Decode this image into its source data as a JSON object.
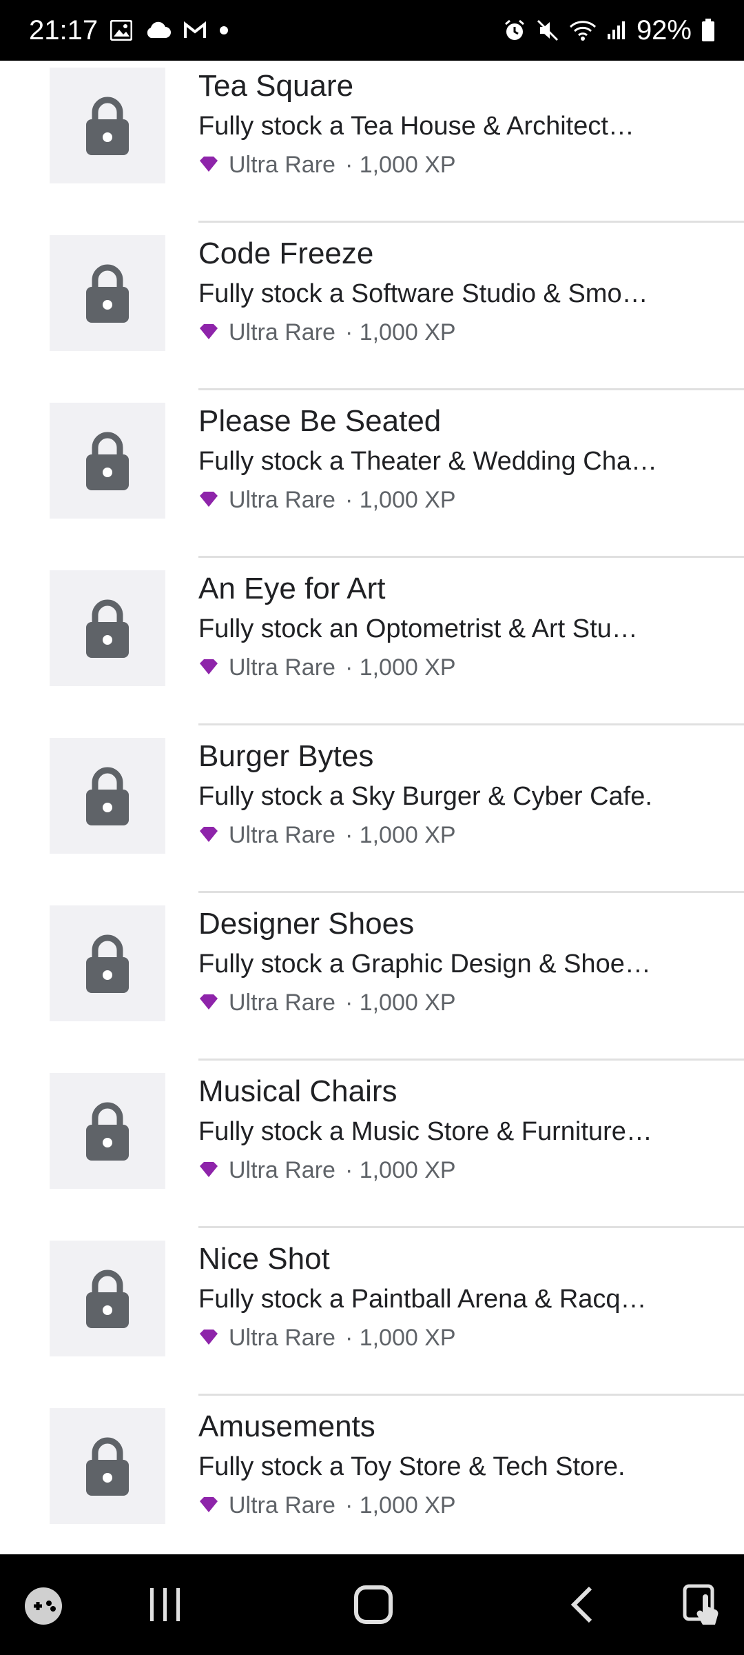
{
  "status_bar": {
    "time": "21:17",
    "battery": "92%",
    "icons_left": [
      "image-icon",
      "cloud-icon",
      "gmail-icon",
      "dot-icon"
    ],
    "icons_right": [
      "alarm-icon",
      "mute-icon",
      "wifi-icon",
      "signal-icon",
      "battery-icon"
    ]
  },
  "achievements": [
    {
      "title": "Tea Square",
      "description": "Fully stock a Tea House & Architect…",
      "rarity": "Ultra Rare",
      "xp": "· 1,000 XP"
    },
    {
      "title": "Code Freeze",
      "description": "Fully stock a Software Studio & Smo…",
      "rarity": "Ultra Rare",
      "xp": "· 1,000 XP"
    },
    {
      "title": "Please Be Seated",
      "description": "Fully stock a Theater & Wedding Cha…",
      "rarity": "Ultra Rare",
      "xp": "· 1,000 XP"
    },
    {
      "title": "An Eye for Art",
      "description": "Fully stock an Optometrist & Art Stu…",
      "rarity": "Ultra Rare",
      "xp": "· 1,000 XP"
    },
    {
      "title": "Burger Bytes",
      "description": "Fully stock a Sky Burger & Cyber Cafe.",
      "rarity": "Ultra Rare",
      "xp": "· 1,000 XP"
    },
    {
      "title": "Designer Shoes",
      "description": "Fully stock a Graphic Design & Shoe…",
      "rarity": "Ultra Rare",
      "xp": "· 1,000 XP"
    },
    {
      "title": "Musical Chairs",
      "description": "Fully stock a Music Store & Furniture…",
      "rarity": "Ultra Rare",
      "xp": "· 1,000 XP"
    },
    {
      "title": "Nice Shot",
      "description": "Fully stock a Paintball Arena & Racq…",
      "rarity": "Ultra Rare",
      "xp": "· 1,000 XP"
    },
    {
      "title": "Amusements",
      "description": "Fully stock a Toy Store & Tech Store.",
      "rarity": "Ultra Rare",
      "xp": "· 1,000 XP"
    }
  ],
  "colors": {
    "rarity_gem": "#8e24aa",
    "lock": "#5f6368",
    "thumb_bg": "#f1f1f4"
  },
  "nav_bar": {
    "buttons": [
      "game-launcher-icon",
      "recent-apps-icon",
      "home-icon",
      "back-icon",
      "screen-touch-icon"
    ]
  }
}
